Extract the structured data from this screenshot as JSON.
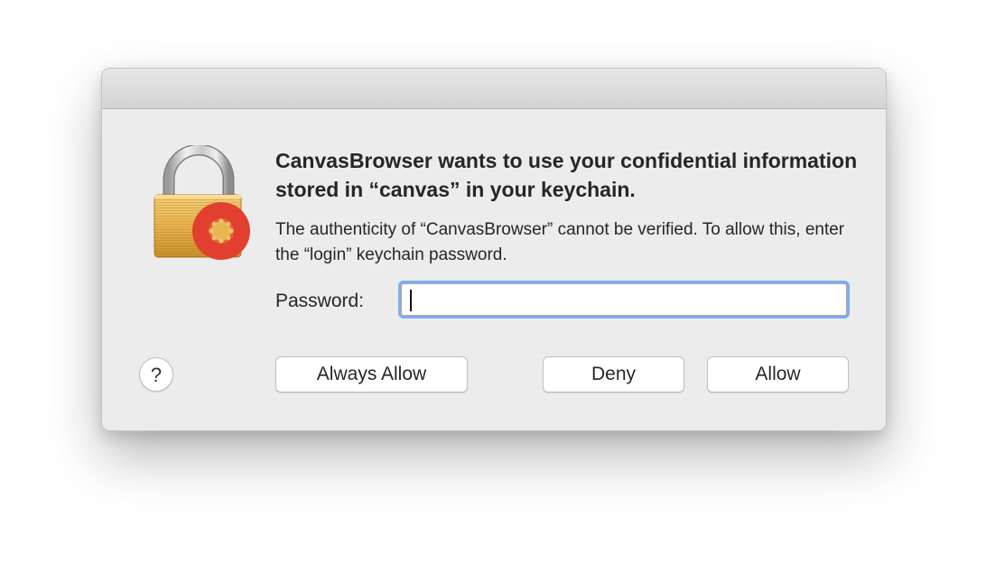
{
  "dialog": {
    "heading": "CanvasBrowser wants to use your confidential information stored in “canvas” in your keychain.",
    "body": "The authenticity of “CanvasBrowser” cannot be verified. To allow this, enter the “login” keychain password.",
    "password_label": "Password:",
    "password_value": "",
    "icon": "keychain-lock-icon",
    "badge_icon": "canvas-logo-icon",
    "colors": {
      "background": "#ececec",
      "focus_ring": "#7fadf0",
      "canvas_red": "#e13f2f",
      "lock_gold": "#e8b550"
    }
  },
  "buttons": {
    "help": "?",
    "always_allow": "Always Allow",
    "deny": "Deny",
    "allow": "Allow"
  }
}
